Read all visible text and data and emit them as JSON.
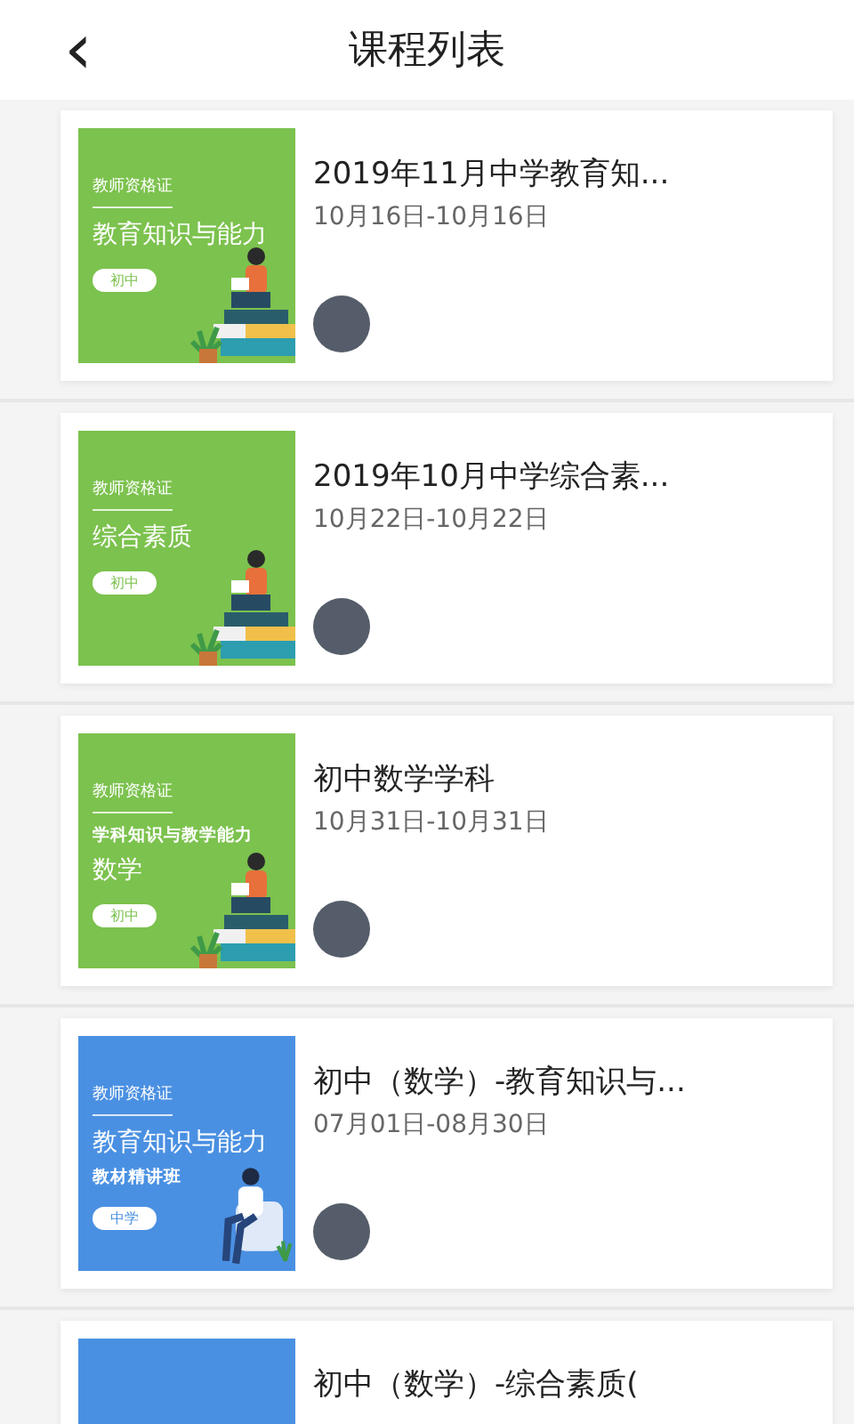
{
  "header": {
    "back_icon": "‹",
    "title": "课程列表"
  },
  "courses": [
    {
      "title": "2019年11月中学教育知...",
      "dates": "10月16日-10月16日",
      "cover": {
        "kind": "green",
        "header": "教师资格证",
        "lines": [
          {
            "text": "教育知识与能力",
            "kind": "large"
          }
        ],
        "badge": "初中"
      }
    },
    {
      "title": "2019年10月中学综合素...",
      "dates": "10月22日-10月22日",
      "cover": {
        "kind": "green",
        "header": "教师资格证",
        "lines": [
          {
            "text": "综合素质",
            "kind": "large"
          }
        ],
        "badge": "初中"
      }
    },
    {
      "title": "初中数学学科",
      "dates": "10月31日-10月31日",
      "cover": {
        "kind": "green",
        "header": "教师资格证",
        "lines": [
          {
            "text": "学科知识与教学能力",
            "kind": "small"
          },
          {
            "text": "数学",
            "kind": "large"
          }
        ],
        "badge": "初中"
      }
    },
    {
      "title": "初中（数学）-教育知识与...",
      "dates": "07月01日-08月30日",
      "cover": {
        "kind": "blue",
        "header": "教师资格证",
        "lines": [
          {
            "text": "教育知识与能力",
            "kind": "large"
          },
          {
            "text": "教材精讲班",
            "kind": "small"
          }
        ],
        "badge": "中学"
      }
    },
    {
      "title": "初中（数学）-综合素质(",
      "cover": {
        "kind": "blue"
      }
    }
  ]
}
